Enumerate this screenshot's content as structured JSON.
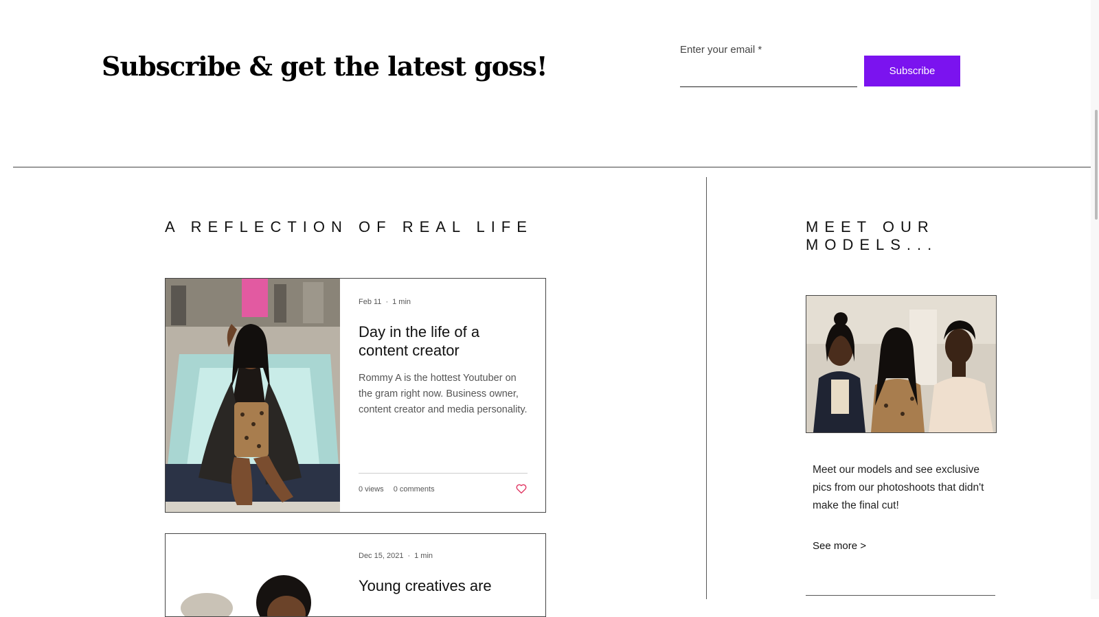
{
  "subscribe": {
    "title": "Subscribe & get the latest goss!",
    "email_label": "Enter your email *",
    "email_value": "",
    "button_label": "Subscribe"
  },
  "blog": {
    "heading": "A REFLECTION OF REAL LIFE",
    "posts": [
      {
        "date": "Feb 11",
        "read_time": "1 min",
        "title": "Day in the life of a content creator",
        "excerpt": "Rommy A is the hottest Youtuber on the gram right now. Business owner, content creator and media personality.",
        "views": "0 views",
        "comments": "0 comments",
        "liked": false
      },
      {
        "date": "Dec 15, 2021",
        "read_time": "1 min",
        "title": "Young creatives are"
      }
    ]
  },
  "sidebar": {
    "heading": "MEET OUR MODELS...",
    "text": "Meet our models and see exclusive pics from our photoshoots that didn't make the final cut!",
    "link_label": "See more >"
  },
  "icons": {
    "like": "heart-icon"
  },
  "colors": {
    "accent": "#7b13ef",
    "like": "#e0325f"
  }
}
